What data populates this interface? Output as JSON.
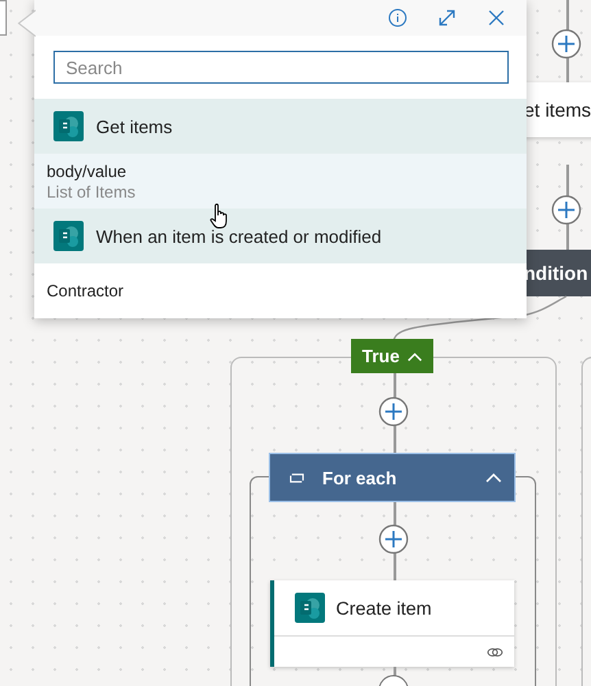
{
  "canvas": {
    "right_column": [
      {
        "kind": "card",
        "title": "et items"
      },
      {
        "kind": "condition",
        "title": "ndition"
      }
    ],
    "branch": {
      "label": "True",
      "expanded": true
    },
    "loop": {
      "title": "For each",
      "expanded": true
    },
    "action": {
      "title": "Create item"
    }
  },
  "popup": {
    "search": {
      "placeholder": "Search"
    },
    "items": [
      {
        "kind": "source",
        "title": "Get items"
      },
      {
        "kind": "token",
        "title": "body/value",
        "subtitle": "List of Items",
        "highlighted": true
      },
      {
        "kind": "source",
        "title": "When an item is created or modified"
      },
      {
        "kind": "token",
        "title": "Contractor",
        "highlighted": false
      }
    ]
  }
}
